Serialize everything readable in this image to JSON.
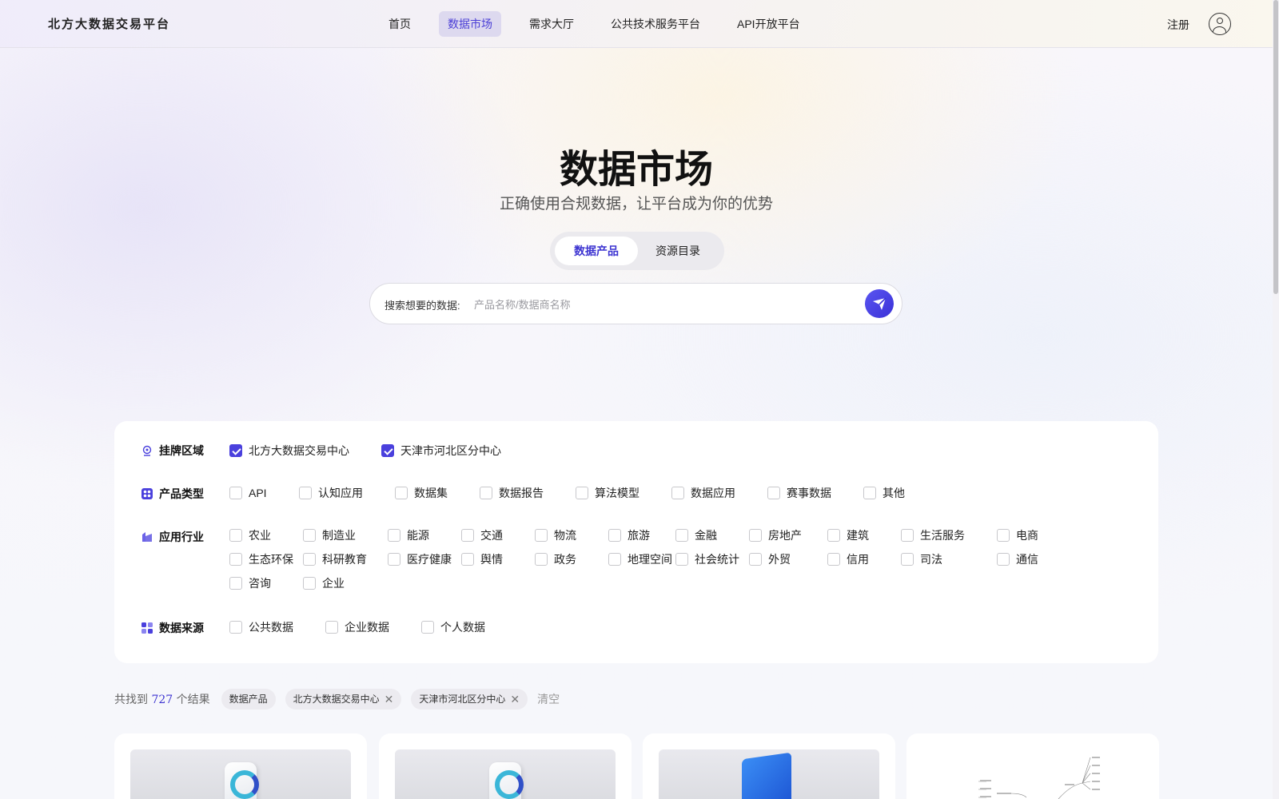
{
  "header": {
    "logo": "北方大数据交易平台",
    "nav": [
      "首页",
      "数据市场",
      "需求大厅",
      "公共技术服务平台",
      "API开放平台"
    ],
    "active_nav": "数据市场",
    "register": "注册"
  },
  "hero": {
    "title": "数据市场",
    "subtitle": "正确使用合规数据，让平台成为你的优势",
    "tabs": [
      "数据产品",
      "资源目录"
    ],
    "active_tab": "数据产品"
  },
  "search": {
    "label": "搜索想要的数据:",
    "placeholder": "产品名称/数据商名称",
    "value": ""
  },
  "filters": {
    "region": {
      "label": "挂牌区域",
      "options": [
        {
          "label": "北方大数据交易中心",
          "checked": true
        },
        {
          "label": "天津市河北区分中心",
          "checked": true
        }
      ]
    },
    "product_type": {
      "label": "产品类型",
      "options": [
        "API",
        "认知应用",
        "数据集",
        "数据报告",
        "算法模型",
        "数据应用",
        "赛事数据",
        "其他"
      ]
    },
    "industry": {
      "label": "应用行业",
      "options": [
        "农业",
        "制造业",
        "能源",
        "交通",
        "物流",
        "旅游",
        "金融",
        "房地产",
        "建筑",
        "生活服务",
        "电商",
        "生态环保",
        "科研教育",
        "医疗健康",
        "舆情",
        "政务",
        "地理空间",
        "社会统计",
        "外贸",
        "信用",
        "司法",
        "通信",
        "咨询",
        "企业"
      ]
    },
    "data_source": {
      "label": "数据来源",
      "options": [
        "公共数据",
        "企业数据",
        "个人数据"
      ]
    }
  },
  "results": {
    "prefix": "共找到",
    "count": "727",
    "suffix": "个结果",
    "chips": [
      "数据产品",
      "北方大数据交易中心",
      "天津市河北区分中心"
    ],
    "clear": "清空"
  },
  "colors": {
    "accent": "#4a40dd",
    "active_nav_bg": "#d3cfec"
  }
}
